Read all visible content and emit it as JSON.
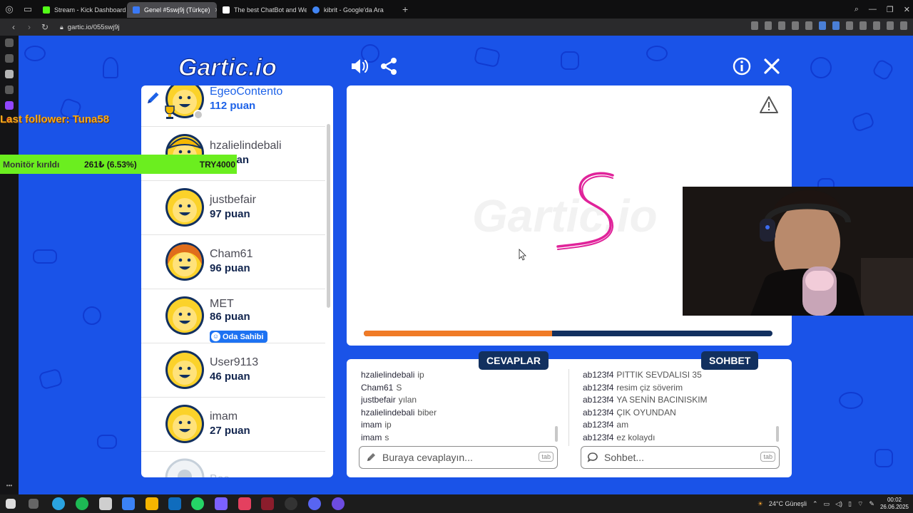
{
  "browser": {
    "tabs": [
      {
        "label": "Stream - Kick Dashboard",
        "color": "#53fc18",
        "active": false
      },
      {
        "label": "Genel #5swj9j (Türkçe)",
        "color": "#3a79f7",
        "active": true
      },
      {
        "label": "The best ChatBot and We",
        "color": "#ffffff",
        "active": false
      },
      {
        "label": "kibrit - Google'da Ara",
        "color": "#4285f4",
        "active": false
      }
    ],
    "url": "gartic.io/055swj9j"
  },
  "game": {
    "logo_text": "Gartic.io",
    "players": [
      {
        "name": "EgeoContento",
        "points": "112 puan",
        "drawing": true,
        "highlight": true
      },
      {
        "name": "hzalielindebali",
        "points": "… puan"
      },
      {
        "name": "justbefair",
        "points": "97 puan"
      },
      {
        "name": "Cham61",
        "points": "96 puan"
      },
      {
        "name": "MET",
        "points": "86 puan",
        "badge": "Oda Sahibi"
      },
      {
        "name": "User9113",
        "points": "46 puan"
      },
      {
        "name": "imam",
        "points": "27 puan"
      },
      {
        "name": "Boş",
        "points": ""
      }
    ],
    "canvas": {
      "watermark": "Gartic.io",
      "drawn_letter": "S",
      "time_progress": 0.46
    },
    "answers": {
      "tab_label": "CEVAPLAR",
      "placeholder": "Buraya cevaplayın...",
      "key_hint": "tab",
      "messages": [
        {
          "user": "hzalielindebali",
          "text": "ip"
        },
        {
          "user": "Cham61",
          "text": "S"
        },
        {
          "user": "justbefair",
          "text": "yılan"
        },
        {
          "user": "hzalielindebali",
          "text": "biber"
        },
        {
          "user": "imam",
          "text": "ip"
        },
        {
          "user": "imam",
          "text": "s"
        }
      ]
    },
    "chat": {
      "tab_label": "SOHBET",
      "placeholder": "Sohbet...",
      "key_hint": "tab",
      "messages": [
        {
          "user": "ab123f4",
          "text": "PITTIK SEVDALISI 35"
        },
        {
          "user": "ab123f4",
          "text": "resim çiz söverim"
        },
        {
          "user": "ab123f4",
          "text": "YA SENİN BACINISKIM"
        },
        {
          "user": "ab123f4",
          "text": "ÇIK OYUNDAN"
        },
        {
          "user": "ab123f4",
          "text": "am"
        },
        {
          "user": "ab123f4",
          "text": "ez kolaydı"
        }
      ]
    }
  },
  "overlay": {
    "last_follower": "Last follower: Tuna58",
    "goal": {
      "title": "Monitör kırıldı",
      "current": "261₺ (6.53%)",
      "target": "TRY4000",
      "percent": 6.53
    }
  },
  "taskbar": {
    "weather": "24°C Güneşli",
    "time": "00:02",
    "date": "26.06.2025"
  },
  "colors": {
    "game_bg": "#1a53e8",
    "navy": "#12305f",
    "timer": "#f07b26",
    "pen": "#e0239a",
    "goal_green": "#6bee1f",
    "follower": "#f3a91d"
  }
}
